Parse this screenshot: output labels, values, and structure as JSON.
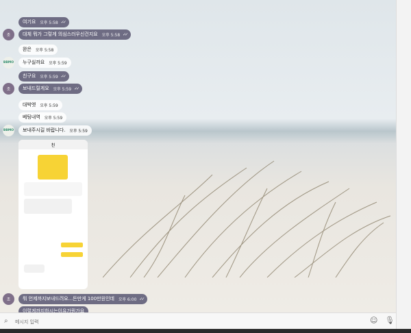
{
  "messages": [
    {
      "text": "여기요",
      "time": "오후 5:58",
      "style": "dark",
      "avatar": "",
      "read": true
    },
    {
      "text": "대체 뭐가 그렇게 의심스러우신건지요",
      "time": "오후 5:58",
      "style": "dark",
      "avatar": "조",
      "read": true
    },
    {
      "text": "완은",
      "time": "오후 5:58",
      "style": "light",
      "avatar": "",
      "read": false
    },
    {
      "text": "누구실까요",
      "time": "오후 5:59",
      "style": "light",
      "avatar": "BBMO",
      "read": false
    },
    {
      "text": "친구요",
      "time": "오후 5:59",
      "style": "dark",
      "avatar": "",
      "read": true
    },
    {
      "text": "보내드릴게요",
      "time": "오후 5:59",
      "style": "dark",
      "avatar": "조",
      "read": true
    },
    {
      "text": "대박엣",
      "time": "오후 5:59",
      "style": "light",
      "avatar": "",
      "read": false
    },
    {
      "text": "베팅내역",
      "time": "오후 5:59",
      "style": "light",
      "avatar": "",
      "read": false
    },
    {
      "text": "보내주시길 바랍니다.",
      "time": "오후 5:59",
      "style": "light",
      "avatar": "BBMO",
      "read": false
    },
    {
      "text": "뭐 언제까지보내드려요...돈만게 100만원인데",
      "time": "오후 6:00",
      "style": "dark",
      "avatar": "조",
      "read": true
    },
    {
      "text": "이렇게까지하시는이유가뭔가요",
      "time": "",
      "style": "dark",
      "avatar": "",
      "read": false
    }
  ],
  "input": {
    "placeholder": "메시지 입력"
  },
  "phone": {
    "title": "친"
  }
}
